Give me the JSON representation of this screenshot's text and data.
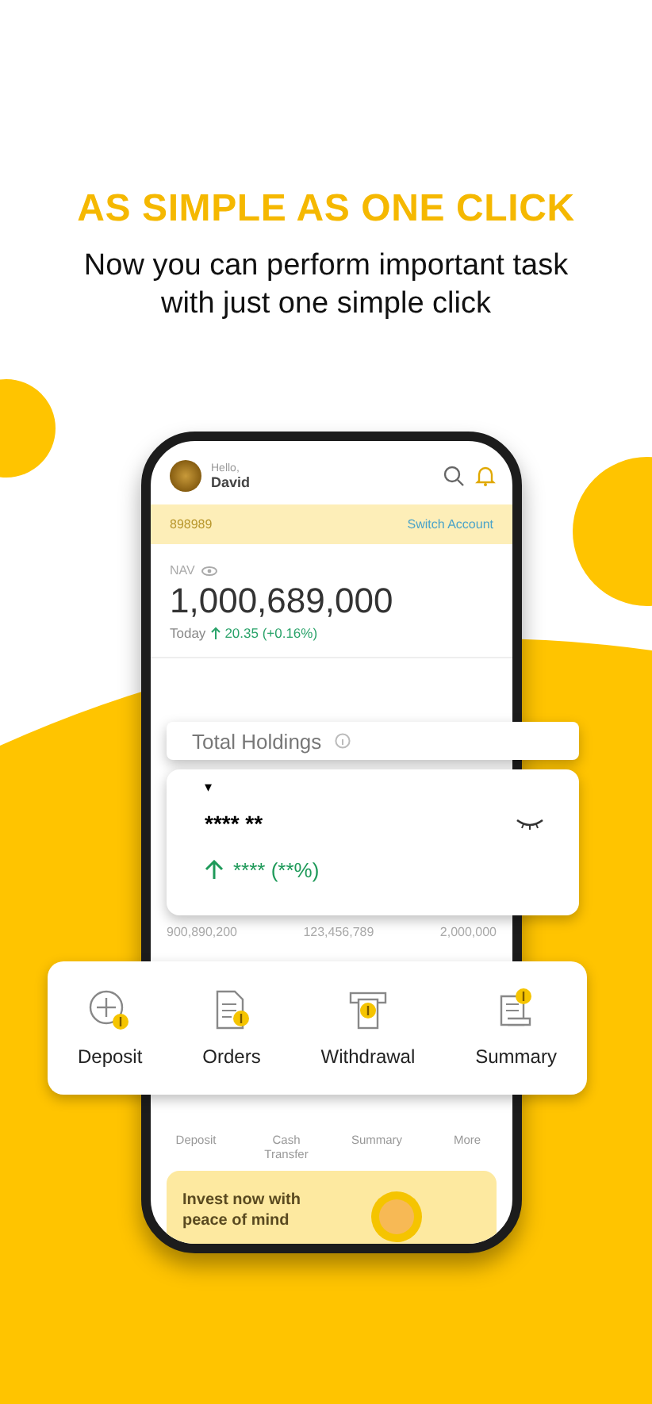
{
  "headline": "AS SIMPLE AS ONE CLICK",
  "subtitle": "Now you can perform important task with just one simple click",
  "phone": {
    "greeting": "Hello,",
    "user": "David",
    "account": "898989",
    "switch_account": "Switch Account",
    "nav_label": "NAV",
    "nav_value": "1,000,689,000",
    "today_label": "Today",
    "today_change": "20.35 (+0.16%)",
    "holdings_values": [
      "900,890,200",
      "123,456,789",
      "2,000,000"
    ],
    "actions": [
      {
        "label": "Deposit"
      },
      {
        "label": "Cash Transfer"
      },
      {
        "label": "Summary"
      },
      {
        "label": "More"
      }
    ],
    "promo": "Invest now with peace of mind"
  },
  "holdings_card": {
    "title": "Total Holdings"
  },
  "hidden_card": {
    "caret": "▾",
    "value": "**** **",
    "change": "**** (**%)"
  },
  "quick_actions": [
    {
      "label": "Deposit",
      "kind": "deposit"
    },
    {
      "label": "Orders",
      "kind": "orders"
    },
    {
      "label": "Withdrawal",
      "kind": "withdrawal"
    },
    {
      "label": "Summary",
      "kind": "summary"
    }
  ]
}
